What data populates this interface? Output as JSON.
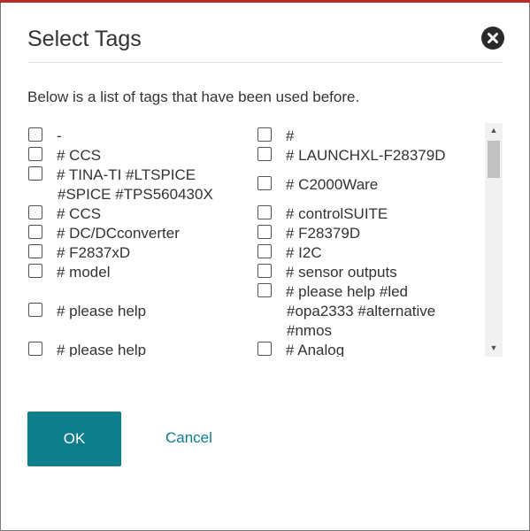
{
  "dialog": {
    "title": "Select Tags",
    "intro": "Below is a list of tags that have been used before.",
    "close_icon": "close-icon",
    "ok_label": "OK",
    "cancel_label": "Cancel"
  },
  "tags": {
    "left": [
      "-",
      "# CCS",
      "# TINA-TI #LTSPICE #SPICE #TPS560430X",
      "# CCS",
      "# DC/DCconverter",
      "# F2837xD",
      "# model",
      "",
      "# please help",
      "",
      "# please help"
    ],
    "right": [
      "#",
      "# LAUNCHXL-F28379D",
      "# C2000Ware",
      "# controlSUITE",
      "# F28379D",
      "# I2C",
      "# sensor outputs",
      "# please help #led #opa2333 #alternative #nmos",
      "# Analog"
    ]
  },
  "colors": {
    "accent": "#0e7d8c",
    "top_bar": "#b52c24"
  }
}
